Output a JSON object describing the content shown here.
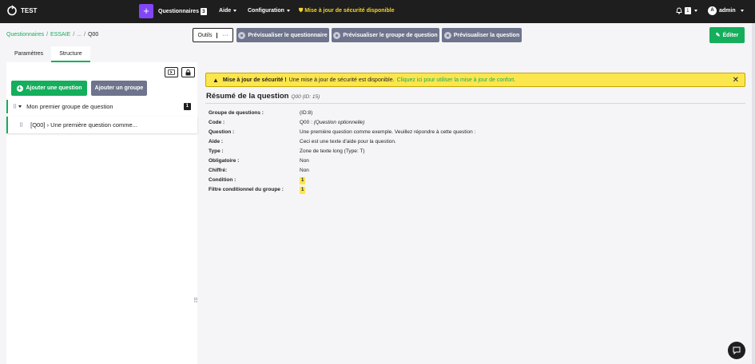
{
  "brand": {
    "name": "TEST"
  },
  "navbar": {
    "plus": "+",
    "questionnaires_label": "Questionnaires",
    "questionnaires_count": "3",
    "aide_label": "Aide",
    "configuration_label": "Configuration",
    "security_alert": "Mise à jour de sécurité disponible",
    "notifications_count": "1",
    "user_initial": "A",
    "user_name": "admin"
  },
  "breadcrumb": {
    "items": [
      "Questionnaires",
      "ESSAIE",
      "...",
      "Q00"
    ]
  },
  "toolbar": {
    "outils": "Outils",
    "dots": "···",
    "preview_questionnaire": "Prévisualiser le questionnaire",
    "preview_group": "Prévisualiser le groupe de question",
    "preview_question": "Prévisualiser la question",
    "edit": "Éditer"
  },
  "tabs": [
    {
      "label": "Paramètres",
      "active": false
    },
    {
      "label": "Structure",
      "active": true
    }
  ],
  "structure": {
    "add_question": "Ajouter une question",
    "add_group": "Ajouter un groupe",
    "group": {
      "name": "Mon premier groupe de question",
      "count": "1"
    },
    "question": {
      "label": "[Q00] › Une première question comme..."
    }
  },
  "alert": {
    "title": "Mise à jour de sécurité !",
    "text": "Une mise à jour de sécurité est disponible.",
    "link": "Cliquez ici pour utiliser la mise à jour de confort."
  },
  "summary": {
    "title": "Résumé de la question",
    "subtitle": "Q00 (ID: 15)",
    "rows": [
      {
        "key": "Groupe de questions :",
        "value": "(ID:8)"
      },
      {
        "key": "Code :",
        "value": "Q00 : ",
        "value_italic": "(Question optionnelle)"
      },
      {
        "key": "Question :",
        "value": "Une première question comme exemple. Veuillez répondre à cette question :"
      },
      {
        "key": "Aide :",
        "value": "Ceci est une texte d'aide pour la question."
      },
      {
        "key": "Type :",
        "value": "Zone de texte long (Type: T)"
      },
      {
        "key": "Obligatoire :",
        "value": "Non"
      },
      {
        "key": "Chiffré:",
        "value": "Non"
      },
      {
        "key": "Condition :",
        "badge": "1"
      },
      {
        "key": "Filtre conditionnel du groupe :",
        "badge": "1"
      }
    ]
  },
  "colors": {
    "accent": "#14ae5c",
    "purple": "#8146f6",
    "warning": "#fce64e",
    "dark": "#1e1e1e",
    "grey": "#6e748c"
  }
}
